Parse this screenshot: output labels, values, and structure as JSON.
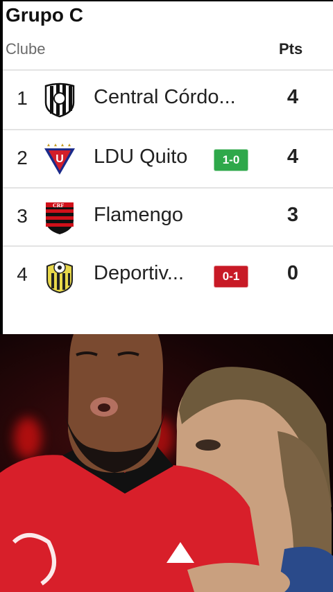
{
  "table": {
    "group_title": "Grupo C",
    "header_club": "Clube",
    "header_pts": "Pts",
    "rows": [
      {
        "pos": "1",
        "club": "Central Córdo...",
        "crest": "central-cordoba-crest-icon",
        "result": "",
        "pts": "4"
      },
      {
        "pos": "2",
        "club": "LDU Quito",
        "crest": "ldu-quito-crest-icon",
        "result": "1-0",
        "result_color": "#2ea84a",
        "pts": "4"
      },
      {
        "pos": "3",
        "club": "Flamengo",
        "crest": "flamengo-crest-icon",
        "result": "",
        "pts": "3"
      },
      {
        "pos": "4",
        "club": "Deportiv...",
        "crest": "deportivo-tachira-crest-icon",
        "result": "0-1",
        "result_color": "#c81a26",
        "pts": "0"
      }
    ]
  }
}
